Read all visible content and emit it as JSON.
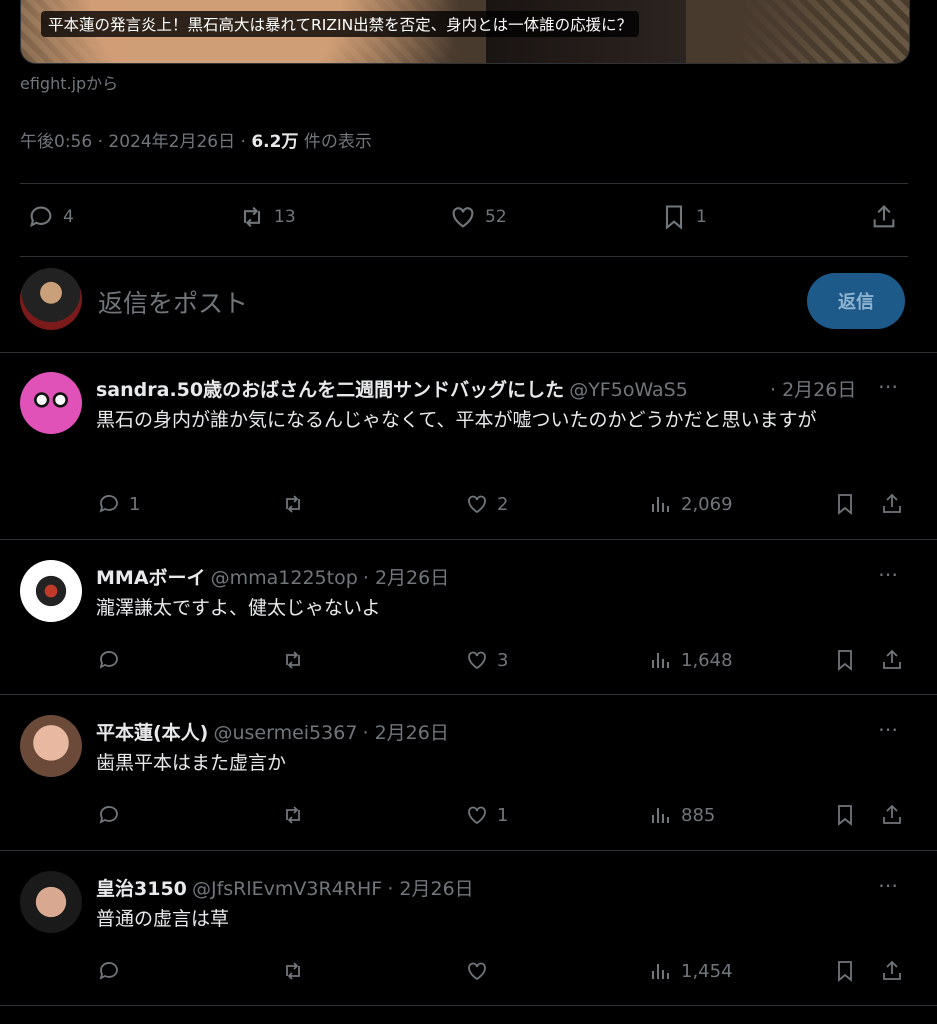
{
  "card": {
    "title": "平本蓮の発言炎上！黒石高大は暴れてRIZIN出禁を否定、身内とは一体誰の応援に？",
    "source": "efight.jpから"
  },
  "meta": {
    "time": "午後0:56 · 2024年2月26日 · ",
    "views": "6.2万",
    "views_label": " 件の表示"
  },
  "actions": {
    "replies": "4",
    "reposts": "13",
    "likes": "52",
    "bookmarks": "1"
  },
  "composer": {
    "placeholder": "返信をポスト",
    "button": "返信"
  },
  "replies": [
    {
      "name": "sandra.50歳のおばさんを二週間サンドバッグにした",
      "handle": "@YF5oWaS5",
      "date": "· 2月26日",
      "text": "黒石の身内が誰か気になるんじゃなくて、平本が嘘ついたのかどうかだと思いますが",
      "replies": "1",
      "reposts": "",
      "likes": "2",
      "views": "2,069"
    },
    {
      "name": "MMAボーイ",
      "handle": "@mma1225top",
      "date": "· 2月26日",
      "text": "瀧澤謙太ですよ、健太じゃないよ",
      "replies": "",
      "reposts": "",
      "likes": "3",
      "views": "1,648"
    },
    {
      "name": "平本蓮(本人)",
      "handle": "@usermei5367",
      "date": "· 2月26日",
      "text": "歯黒平本はまた虚言か",
      "replies": "",
      "reposts": "",
      "likes": "1",
      "views": "885"
    },
    {
      "name": "皇治3150",
      "handle": "@JfsRlEvmV3R4RHF",
      "date": "· 2月26日",
      "text": "普通の虚言は草",
      "replies": "",
      "reposts": "",
      "likes": "",
      "views": "1,454"
    }
  ],
  "icons": {
    "more": "⋯",
    "reply": "reply-icon",
    "repost": "repost-icon",
    "like": "heart-icon",
    "views": "views-icon",
    "bookmark": "bookmark-icon",
    "share": "share-icon"
  },
  "colors": {
    "background": "#000000",
    "muted": "#71767b",
    "text": "#e7e9ea",
    "accent": "#1d9bf0"
  }
}
